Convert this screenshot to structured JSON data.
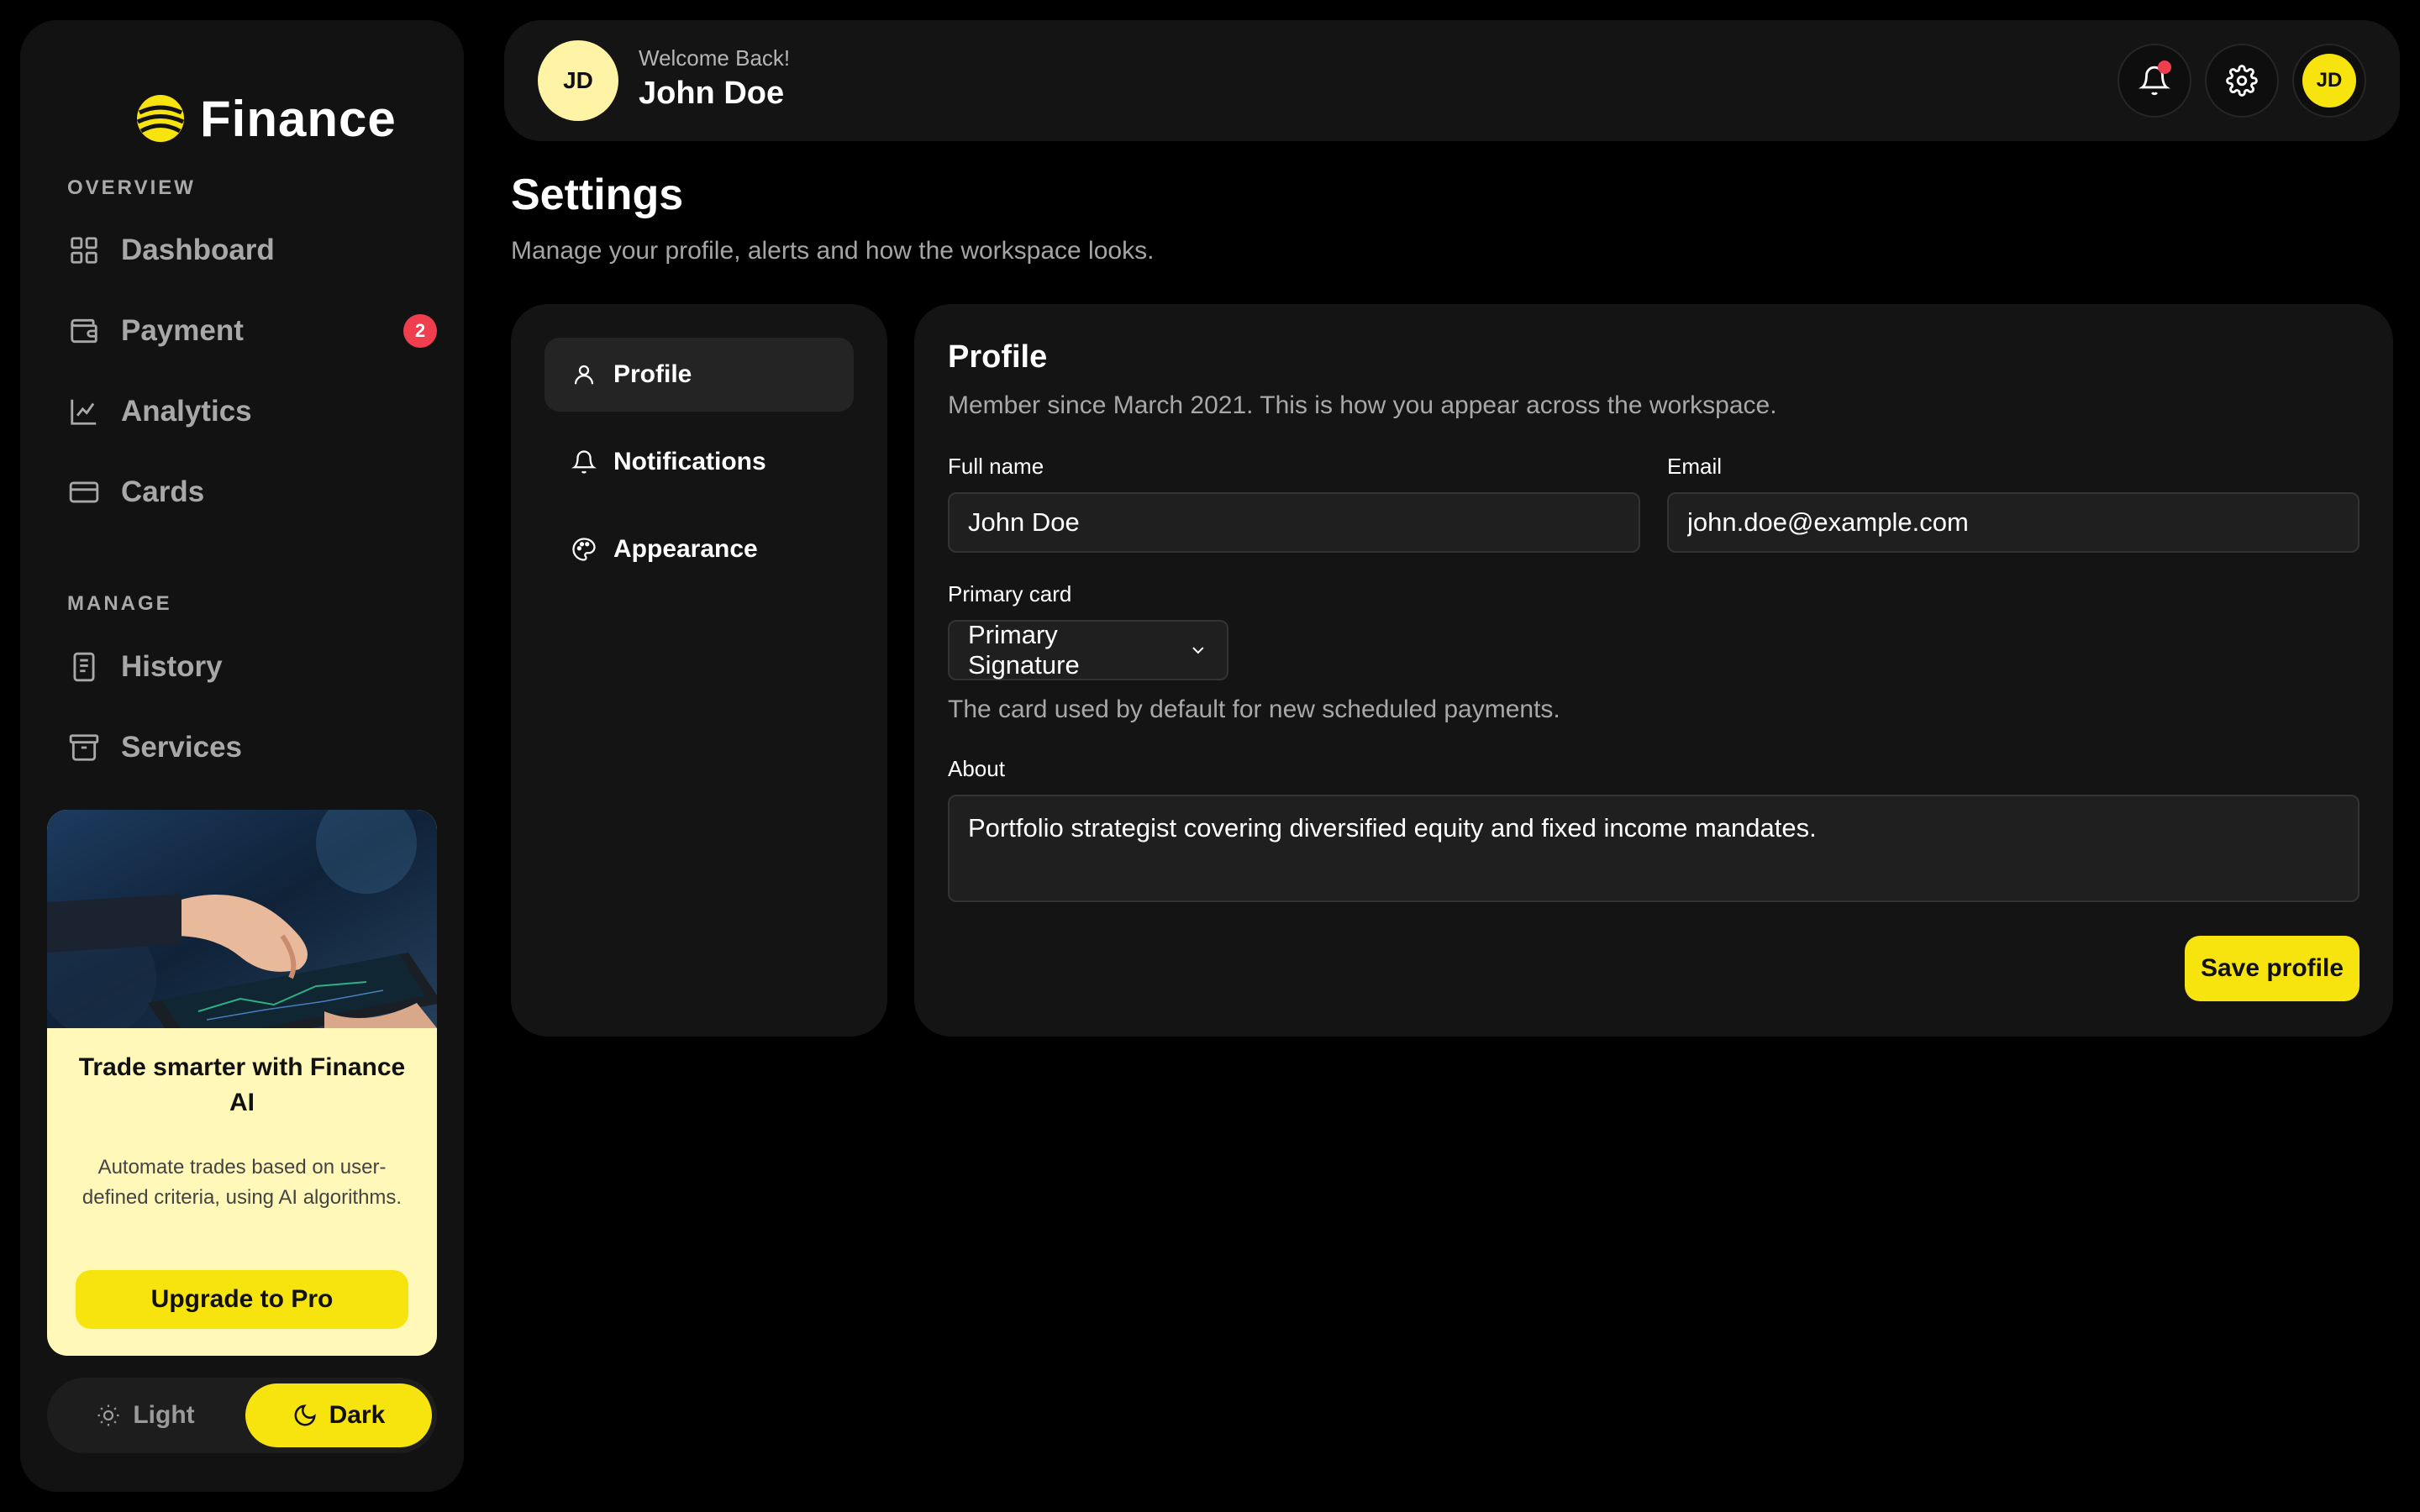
{
  "brand": {
    "name": "Finance",
    "logo_icon": "brand-logo-icon",
    "accent": "#f7e40e"
  },
  "sidebar": {
    "overview_label": "OVERVIEW",
    "manage_label": "MANAGE",
    "overview_items": [
      {
        "label": "Dashboard",
        "icon": "grid-icon"
      },
      {
        "label": "Payment",
        "icon": "wallet-icon",
        "badge": "2"
      },
      {
        "label": "Analytics",
        "icon": "chart-line-icon"
      },
      {
        "label": "Cards",
        "icon": "credit-card-icon"
      }
    ],
    "manage_items": [
      {
        "label": "History",
        "icon": "receipt-icon"
      },
      {
        "label": "Services",
        "icon": "archive-icon"
      }
    ],
    "promo": {
      "title": "Trade smarter with Finance AI",
      "text": "Automate trades based on user-defined criteria, using AI algorithms.",
      "button": "Upgrade to Pro"
    },
    "theme": {
      "light": "Light",
      "dark": "Dark",
      "selected": "Dark"
    }
  },
  "header": {
    "avatar_initials": "JD",
    "welcome": "Welcome Back!",
    "user_name": "John Doe",
    "badge_color": "#ef3f4f"
  },
  "page": {
    "title": "Settings",
    "subtitle": "Manage your profile, alerts and how the workspace looks."
  },
  "settings_nav": [
    {
      "label": "Profile",
      "icon": "user-icon",
      "active": true
    },
    {
      "label": "Notifications",
      "icon": "bell-icon",
      "active": false
    },
    {
      "label": "Appearance",
      "icon": "palette-icon",
      "active": false
    }
  ],
  "profile": {
    "title": "Profile",
    "description": "Member since March 2021. This is how you appear across the workspace.",
    "full_name_label": "Full name",
    "full_name_value": "John Doe",
    "email_label": "Email",
    "email_value": "john.doe@example.com",
    "primary_card_label": "Primary card",
    "primary_card_value": "Primary Signature",
    "primary_card_help": "The card used by default for new scheduled payments.",
    "about_label": "About",
    "about_value": "Portfolio strategist covering diversified equity and fixed income mandates.",
    "save_label": "Save profile"
  }
}
